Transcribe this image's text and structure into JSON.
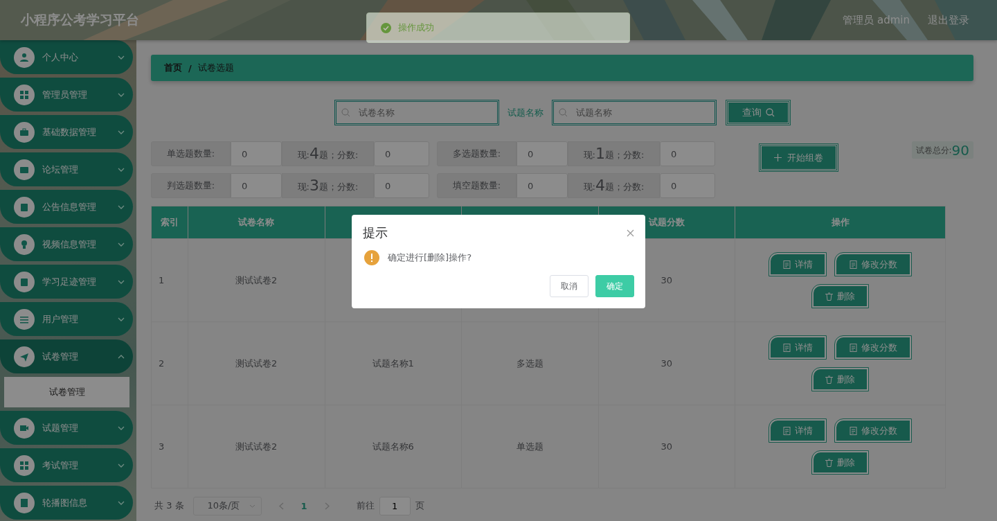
{
  "header": {
    "title": "小程序公考学习平台",
    "user": "管理员 admin",
    "logout": "退出登录"
  },
  "toast": {
    "text": "操作成功"
  },
  "sidebar": {
    "items": [
      {
        "label": "个人中心",
        "expanded": false
      },
      {
        "label": "管理员管理",
        "expanded": false
      },
      {
        "label": "基础数据管理",
        "expanded": false
      },
      {
        "label": "论坛管理",
        "expanded": false
      },
      {
        "label": "公告信息管理",
        "expanded": false
      },
      {
        "label": "视频信息管理",
        "expanded": false
      },
      {
        "label": "学习足迹管理",
        "expanded": false
      },
      {
        "label": "用户管理",
        "expanded": false
      },
      {
        "label": "试卷管理",
        "expanded": true,
        "children": [
          {
            "label": "试卷管理",
            "selected": true
          }
        ]
      },
      {
        "label": "试题管理",
        "expanded": false
      },
      {
        "label": "考试管理",
        "expanded": false
      },
      {
        "label": "轮播图信息",
        "expanded": false
      }
    ]
  },
  "breadcrumb": {
    "items": [
      "首页",
      "试卷选题"
    ],
    "separator": "/"
  },
  "search": {
    "paper_placeholder": "试卷名称",
    "question_label": "试题名称",
    "question_placeholder": "试题名称",
    "button": "查询"
  },
  "stats": [
    {
      "label": "单选题数量:",
      "count": "0",
      "now_label": "现:",
      "now": "4",
      "now_unit": "题；分数:",
      "score": "0"
    },
    {
      "label": "多选题数量:",
      "count": "0",
      "now_label": "现:",
      "now": "1",
      "now_unit": "题；分数:",
      "score": "0"
    },
    {
      "label": "判选题数量:",
      "count": "0",
      "now_label": "现:",
      "now": "3",
      "now_unit": "题；分数:",
      "score": "0"
    },
    {
      "label": "填空题数量:",
      "count": "0",
      "now_label": "现:",
      "now": "4",
      "now_unit": "题；分数:",
      "score": "0"
    }
  ],
  "start_button": "开始组卷",
  "total": {
    "label": "试卷总分:",
    "value": "90"
  },
  "table": {
    "columns": [
      {
        "label": "索引"
      },
      {
        "label": "试卷名称"
      },
      {},
      {},
      {
        "label": "试题分数"
      },
      {
        "label": "操作"
      }
    ],
    "rows": [
      {
        "cells": [
          "1",
          "测试试卷2",
          null,
          null,
          "30"
        ],
        "actions": [
          "详情",
          "修改分数",
          "删除"
        ]
      },
      {
        "cells": [
          "2",
          "测试试卷2",
          "试题名称1",
          "多选题",
          "30"
        ],
        "actions": [
          "详情",
          "修改分数",
          "删除"
        ]
      },
      {
        "cells": [
          "3",
          "测试试卷2",
          "试题名称6",
          "单选题",
          "30"
        ],
        "actions": [
          "详情",
          "修改分数",
          "删除"
        ]
      }
    ]
  },
  "pagination": {
    "total": "共 3 条",
    "page_size": "10条/页",
    "current": "1",
    "goto_label": "前往",
    "goto_value": "1",
    "goto_unit": "页"
  },
  "dialog": {
    "title": "提示",
    "message": "确定进行[删除]操作?",
    "cancel": "取消",
    "confirm": "确定"
  }
}
